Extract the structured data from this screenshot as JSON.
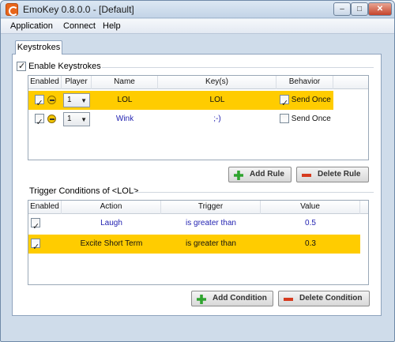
{
  "window": {
    "title": "EmoKey 0.8.0.0 - [Default]",
    "minimize": "–",
    "maximize": "□",
    "close": "✕"
  },
  "menu": [
    "Application",
    "Connect",
    "Help"
  ],
  "tab": "Keystrokes",
  "enable_keystrokes": {
    "label": "Enable Keystrokes",
    "checked": true
  },
  "rules_table": {
    "columns": [
      "Enabled",
      "Player",
      "Name",
      "Key(s)",
      "Behavior"
    ],
    "rows": [
      {
        "enabled": true,
        "player": "1",
        "name": "LOL",
        "keys": "LOL",
        "send_once": true,
        "behavior": "Send Once",
        "selected": true
      },
      {
        "enabled": true,
        "player": "1",
        "name": "Wink",
        "keys": ";-)",
        "send_once": false,
        "behavior": "Send Once",
        "selected": false
      }
    ]
  },
  "rule_buttons": {
    "add": "Add Rule",
    "delete": "Delete Rule"
  },
  "trigger_label": "Trigger Conditions of <LOL>",
  "conditions_table": {
    "columns": [
      "Enabled",
      "Action",
      "Trigger",
      "Value"
    ],
    "rows": [
      {
        "enabled": true,
        "action": "Laugh",
        "trigger": "is greater than",
        "value": "0.5",
        "selected": false
      },
      {
        "enabled": true,
        "action": "Excite Short Term",
        "trigger": "is greater than",
        "value": "0.3",
        "selected": true
      }
    ]
  },
  "condition_buttons": {
    "add": "Add Condition",
    "delete": "Delete Condition"
  },
  "colors": {
    "selected_row": "#ffcc00",
    "link_text": "#1f1fb0"
  }
}
